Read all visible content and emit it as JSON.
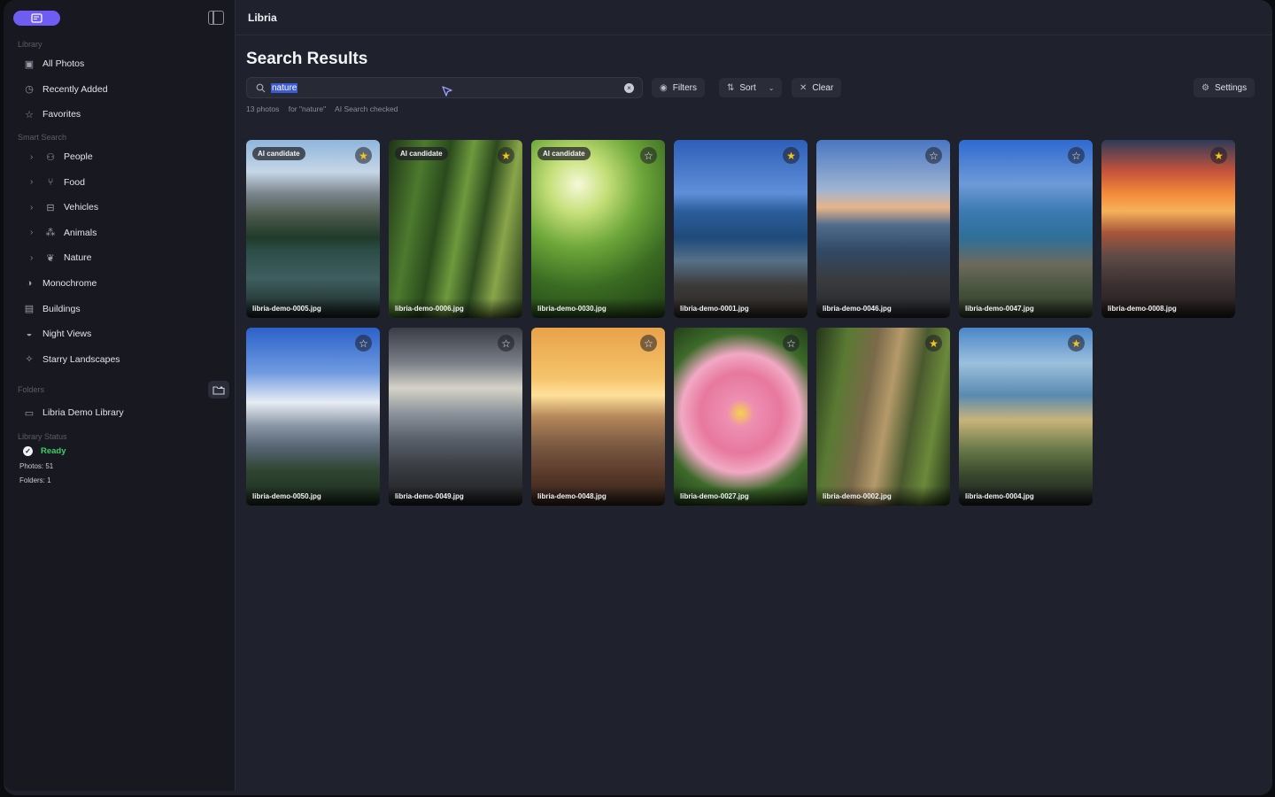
{
  "app": {
    "title": "Libria"
  },
  "sidebar": {
    "library_label": "Library",
    "library_items": [
      {
        "label": "All Photos",
        "icon": "photos-icon"
      },
      {
        "label": "Recently Added",
        "icon": "clock-icon"
      },
      {
        "label": "Favorites",
        "icon": "star-icon"
      }
    ],
    "smart_label": "Smart Search",
    "smart_items": [
      {
        "label": "People",
        "icon": "people-icon"
      },
      {
        "label": "Food",
        "icon": "utensils-icon"
      },
      {
        "label": "Vehicles",
        "icon": "car-icon"
      },
      {
        "label": "Animals",
        "icon": "paw-icon"
      },
      {
        "label": "Nature",
        "icon": "leaf-icon"
      }
    ],
    "other_items": [
      {
        "label": "Monochrome",
        "icon": "contrast-icon"
      },
      {
        "label": "Buildings",
        "icon": "building-icon"
      },
      {
        "label": "Night Views",
        "icon": "moon-icon"
      },
      {
        "label": "Starry Landscapes",
        "icon": "sparkle-icon"
      }
    ],
    "folders_label": "Folders",
    "folders": [
      {
        "label": "Libria Demo Library",
        "icon": "folder-icon"
      }
    ],
    "status_label": "Library Status",
    "status": "Ready",
    "photos_count": "Photos: 51",
    "folders_count": "Folders: 1"
  },
  "main": {
    "title": "Search Results",
    "search_value": "nature",
    "filters_label": "Filters",
    "sort_label": "Sort",
    "clear_label": "Clear",
    "settings_label": "Settings",
    "meta": [
      "13 photos",
      "for \"nature\"",
      "AI Search checked"
    ]
  },
  "photos": [
    {
      "file": "libria-demo-0005.jpg",
      "badge": "AI candidate",
      "fav": true,
      "scene": "mountain-lake"
    },
    {
      "file": "libria-demo-0006.jpg",
      "badge": "AI candidate",
      "fav": true,
      "scene": "forest"
    },
    {
      "file": "libria-demo-0030.jpg",
      "badge": "AI candidate",
      "fav": false,
      "scene": "leaves"
    },
    {
      "file": "libria-demo-0001.jpg",
      "badge": "",
      "fav": true,
      "scene": "coast"
    },
    {
      "file": "libria-demo-0046.jpg",
      "badge": "",
      "fav": false,
      "scene": "coast-dusk"
    },
    {
      "file": "libria-demo-0047.jpg",
      "badge": "",
      "fav": false,
      "scene": "coast-rocks"
    },
    {
      "file": "libria-demo-0008.jpg",
      "badge": "",
      "fav": true,
      "scene": "sunset"
    },
    {
      "file": "libria-demo-0050.jpg",
      "badge": "",
      "fav": false,
      "scene": "peak"
    },
    {
      "file": "libria-demo-0049.jpg",
      "badge": "",
      "fav": false,
      "scene": "storm-sea"
    },
    {
      "file": "libria-demo-0048.jpg",
      "badge": "",
      "fav": false,
      "scene": "golden-shore"
    },
    {
      "file": "libria-demo-0027.jpg",
      "badge": "",
      "fav": false,
      "scene": "dahlia"
    },
    {
      "file": "libria-demo-0002.jpg",
      "badge": "",
      "fav": true,
      "scene": "bike-trail"
    },
    {
      "file": "libria-demo-0004.jpg",
      "badge": "",
      "fav": true,
      "scene": "bike-coast"
    }
  ]
}
